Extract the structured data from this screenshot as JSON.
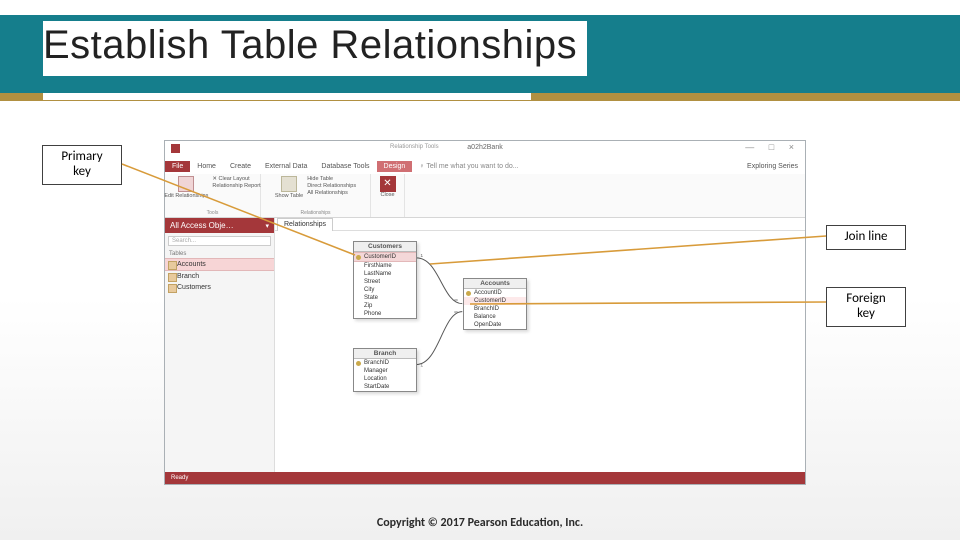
{
  "slide": {
    "title": "Establish Table Relationships",
    "copyright": "Copyright © 2017 Pearson Education, Inc."
  },
  "callouts": {
    "primary_key": "Primary key",
    "join_line": "Join line",
    "foreign_key": "Foreign key"
  },
  "app": {
    "window_title": "a02h2Bank",
    "contextual_tools": "Relationship Tools",
    "tabs": {
      "file": "File",
      "home": "Home",
      "create": "Create",
      "external": "External Data",
      "dbtools": "Database Tools",
      "design": "Design",
      "tell": "♀ Tell me what you want to do...",
      "series": "Exploring Series"
    },
    "ribbon": {
      "g1": {
        "btn": "Edit\nRelationships",
        "label": "Tools",
        "b2": "✕ Clear Layout",
        "b3": "Relationship Report"
      },
      "g2": {
        "btn": "Show\nTable",
        "a": "Hide Table",
        "b": "Direct Relationships",
        "c": "All Relationships",
        "label": "Relationships"
      },
      "g3": {
        "btn": "Close",
        "label": ""
      }
    },
    "nav": {
      "header": "All Access Obje…",
      "search": "Search...",
      "group": "Tables",
      "items": [
        "Accounts",
        "Branch",
        "Customers"
      ]
    },
    "canvas": {
      "tab": "Relationships"
    },
    "tables": {
      "customers": {
        "title": "Customers",
        "fields": [
          "CustomerID",
          "FirstName",
          "LastName",
          "Street",
          "City",
          "State",
          "Zip",
          "Phone"
        ]
      },
      "accounts": {
        "title": "Accounts",
        "fields": [
          "AccountID",
          "CustomerID",
          "BranchID",
          "Balance",
          "OpenDate"
        ]
      },
      "branch": {
        "title": "Branch",
        "fields": [
          "BranchID",
          "Manager",
          "Location",
          "StartDate"
        ]
      }
    },
    "status": "Ready"
  }
}
